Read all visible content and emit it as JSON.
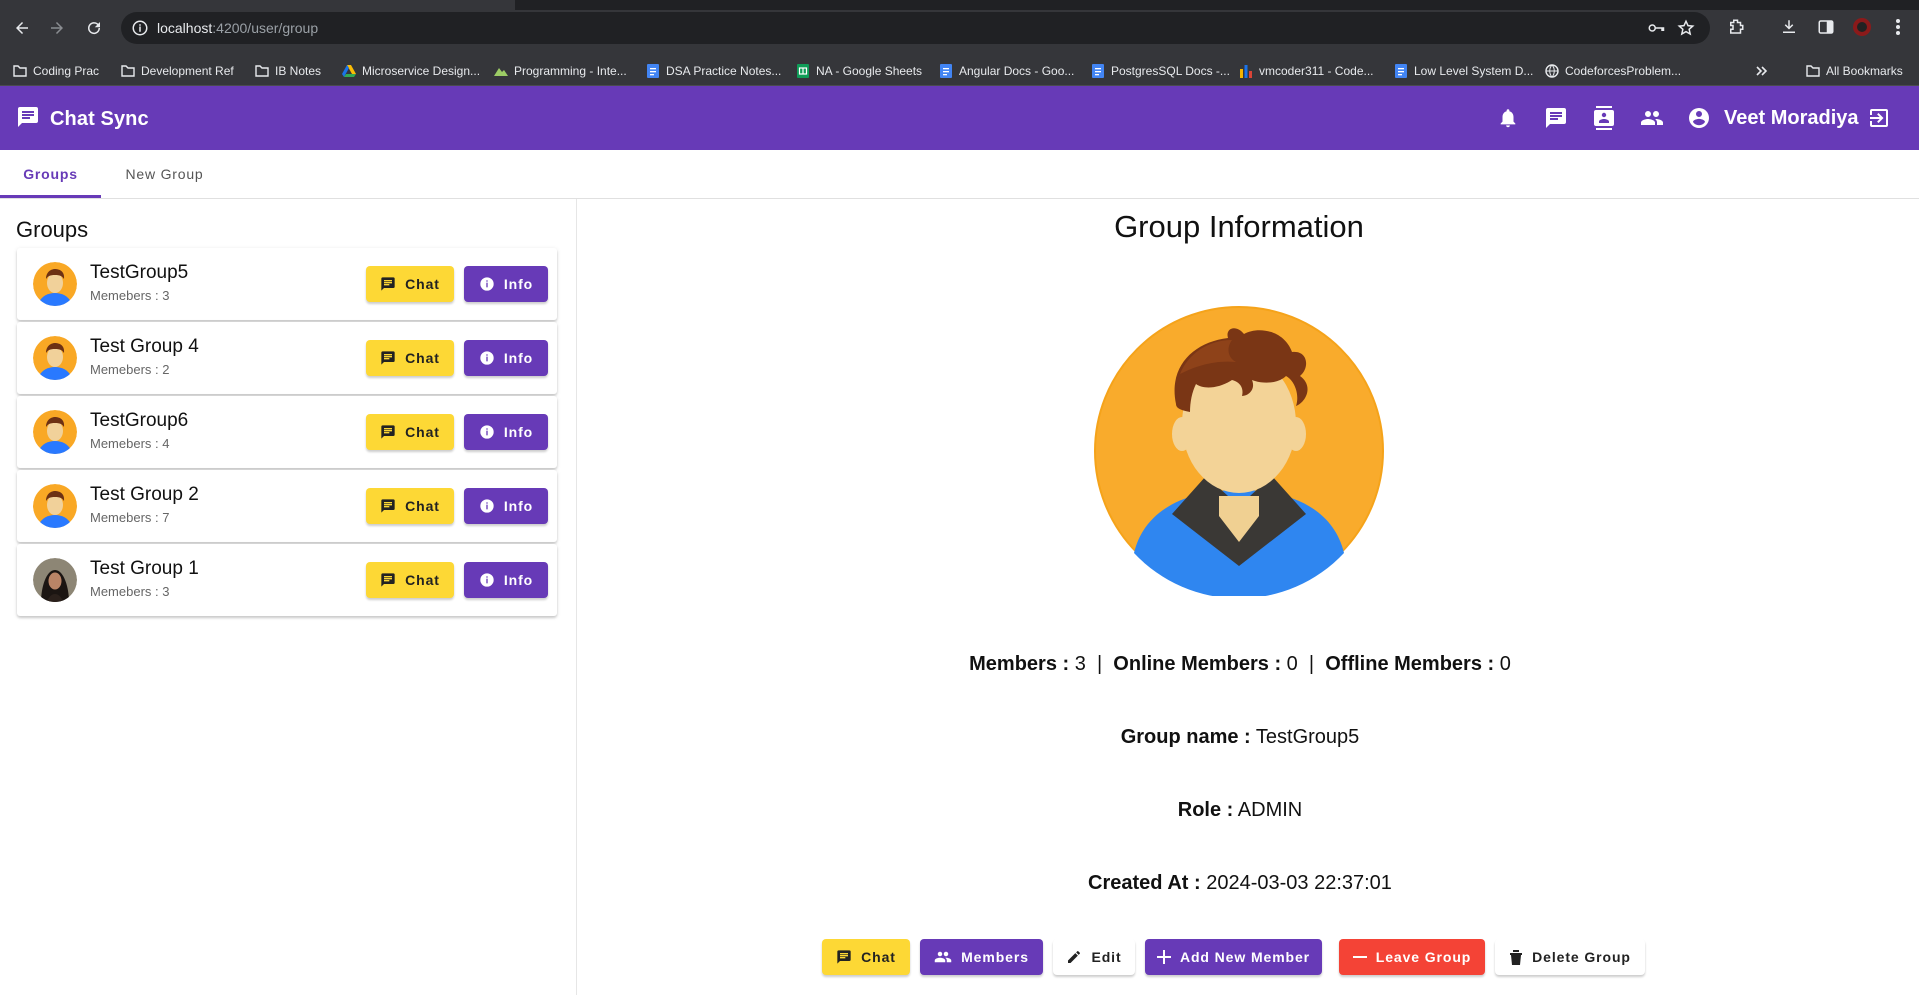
{
  "browser": {
    "url_host": "localhost",
    "url_path": ":4200/user/group",
    "bookmarks": [
      {
        "label": "Coding Prac",
        "icon": "folder-icon"
      },
      {
        "label": "Development Ref",
        "icon": "folder-icon"
      },
      {
        "label": "IB Notes",
        "icon": "folder-icon"
      },
      {
        "label": "Microservice Design...",
        "icon": "drive-icon"
      },
      {
        "label": "Programming - Inte...",
        "icon": "site-icon"
      },
      {
        "label": "DSA Practice Notes...",
        "icon": "docs-icon"
      },
      {
        "label": "NA - Google Sheets",
        "icon": "sheets-icon"
      },
      {
        "label": "Angular Docs - Goo...",
        "icon": "docs-icon"
      },
      {
        "label": "PostgresSQL Docs -...",
        "icon": "docs-icon"
      },
      {
        "label": "vmcoder311 - Code...",
        "icon": "codeforces-icon"
      },
      {
        "label": "Low Level System D...",
        "icon": "docs-icon"
      },
      {
        "label": "CodeforcesProblem...",
        "icon": "globe-icon"
      }
    ],
    "all_bookmarks": "All Bookmarks"
  },
  "app": {
    "title": "Chat Sync",
    "user_name": "Veet Moradiya",
    "accent": "#673ab7",
    "yellow": "#fdd835",
    "red": "#f44336"
  },
  "tabs": [
    {
      "label": "Groups",
      "active": true
    },
    {
      "label": "New Group",
      "active": false
    }
  ],
  "groups_panel": {
    "title": "Groups",
    "chat_label": "Chat",
    "info_label": "Info",
    "groups": [
      {
        "name": "TestGroup5",
        "members": "Memebers : 3",
        "avatar": "cartoon-avatar"
      },
      {
        "name": "Test Group 4",
        "members": "Memebers : 2",
        "avatar": "cartoon-avatar"
      },
      {
        "name": "TestGroup6",
        "members": "Memebers : 4",
        "avatar": "cartoon-avatar"
      },
      {
        "name": "Test Group 2",
        "members": "Memebers : 7",
        "avatar": "cartoon-avatar"
      },
      {
        "name": "Test Group 1",
        "members": "Memebers : 3",
        "avatar": "photo-avatar"
      }
    ]
  },
  "group_info": {
    "title": "Group Information",
    "members_label": "Members :",
    "members_value": "3",
    "online_label": "Online Members :",
    "online_value": "0",
    "offline_label": "Offline Members :",
    "offline_value": "0",
    "separator": "|",
    "name_label": "Group name :",
    "name_value": "TestGroup5",
    "role_label": "Role :",
    "role_value": "ADMIN",
    "created_label": "Created At :",
    "created_value": "2024-03-03 22:37:01",
    "actions": {
      "chat": "Chat",
      "members": "Members",
      "edit": "Edit",
      "add_member": "Add New Member",
      "leave": "Leave Group",
      "delete": "Delete Group"
    }
  }
}
